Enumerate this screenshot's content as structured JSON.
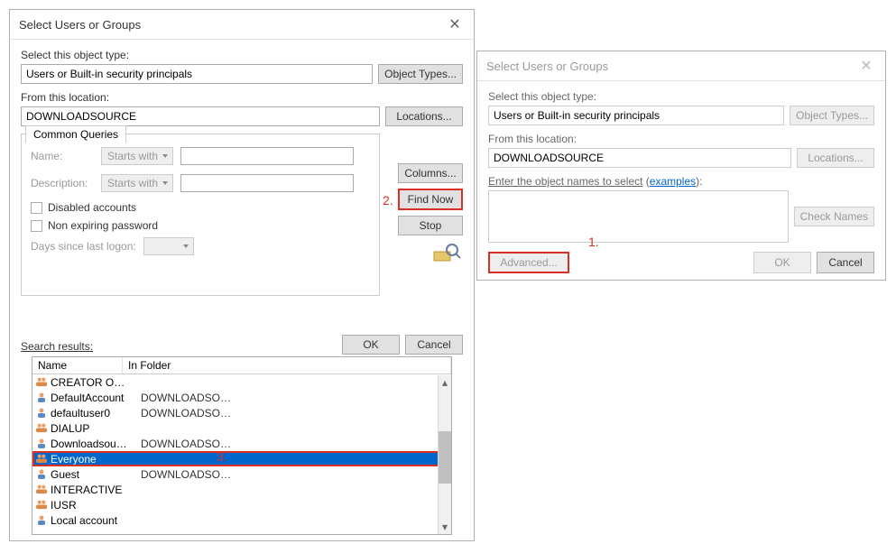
{
  "dialog1": {
    "title": "Select Users or Groups",
    "object_type_label": "Select this object type:",
    "object_type": "Users or Built-in security principals",
    "object_types_btn": "Object Types...",
    "location_label": "From this location:",
    "location": "DOWNLOADSOURCE",
    "locations_btn": "Locations...",
    "common_queries_tab": "Common Queries",
    "name_label": "Name:",
    "name_filter": "Starts with",
    "desc_label": "Description:",
    "desc_filter": "Starts with",
    "cb_disabled": "Disabled accounts",
    "cb_nonexpire": "Non expiring password",
    "days_label": "Days since last logon:",
    "columns_btn": "Columns...",
    "findnow_btn": "Find Now",
    "stop_btn": "Stop",
    "ok_btn": "OK",
    "cancel_btn": "Cancel",
    "results_label": "Search results:",
    "results_columns": {
      "name": "Name",
      "folder": "In Folder"
    },
    "results": [
      {
        "icon": "group",
        "name": "CREATOR O…",
        "folder": ""
      },
      {
        "icon": "person",
        "name": "DefaultAccount",
        "folder": "DOWNLOADSO…"
      },
      {
        "icon": "person",
        "name": "defaultuser0",
        "folder": "DOWNLOADSO…"
      },
      {
        "icon": "group",
        "name": "DIALUP",
        "folder": ""
      },
      {
        "icon": "person",
        "name": "Downloadsou…",
        "folder": "DOWNLOADSO…"
      },
      {
        "icon": "group",
        "name": "Everyone",
        "folder": "",
        "selected": true,
        "highlighted": true
      },
      {
        "icon": "person",
        "name": "Guest",
        "folder": "DOWNLOADSO…"
      },
      {
        "icon": "group",
        "name": "INTERACTIVE",
        "folder": ""
      },
      {
        "icon": "group",
        "name": "IUSR",
        "folder": ""
      },
      {
        "icon": "person",
        "name": "Local account",
        "folder": ""
      }
    ]
  },
  "dialog2": {
    "title": "Select Users or Groups",
    "object_type_label": "Select this object type:",
    "object_type": "Users or Built-in security principals",
    "object_types_btn": "Object Types...",
    "location_label": "From this location:",
    "location": "DOWNLOADSOURCE",
    "locations_btn": "Locations...",
    "names_label": "Enter the object names to select",
    "examples_link": "examples",
    "checknames_btn": "Check Names",
    "advanced_btn": "Advanced...",
    "ok_btn": "OK",
    "cancel_btn": "Cancel"
  },
  "annotations": {
    "a1": "1.",
    "a2": "2.",
    "a3": "3."
  }
}
